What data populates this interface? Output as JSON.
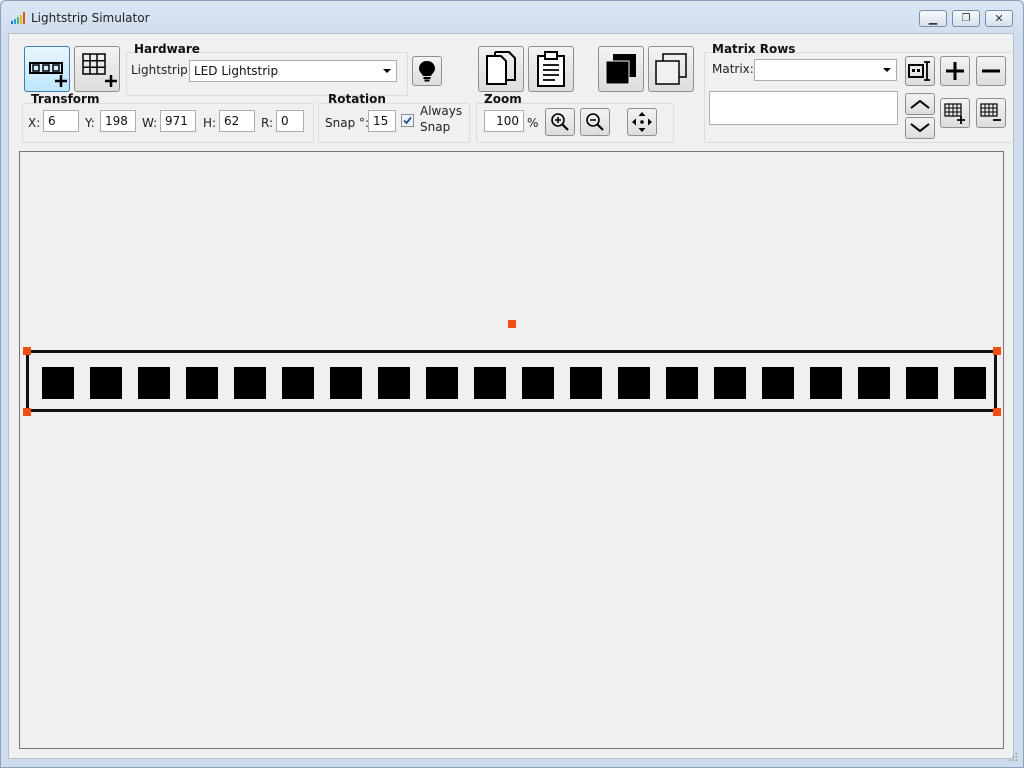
{
  "window": {
    "title": "Lightstrip Simulator",
    "minimize_icon": "minimize-icon",
    "maximize_icon": "restore-icon",
    "close_icon": "close-icon"
  },
  "toolbar": {
    "add_strip_icon": "add-lightstrip-icon",
    "add_matrix_icon": "add-matrix-icon",
    "hardware": {
      "header": "Hardware",
      "label": "Lightstrip:",
      "selected": "LED Lightstrip",
      "bulb_icon": "bulb-icon"
    },
    "transform": {
      "header": "Transform",
      "x_label": "X:",
      "x": "6",
      "y_label": "Y:",
      "y": "198",
      "w_label": "W:",
      "w": "971",
      "h_label": "H:",
      "h": "62",
      "r_label": "R:",
      "r": "0"
    },
    "rotation": {
      "header": "Rotation",
      "snap_label": "Snap °:",
      "snap": "15",
      "always_snap_line1": "Always",
      "always_snap_line2": "Snap",
      "always_snap_checked": true
    },
    "clipboard": {
      "copy_icon": "copy-icon",
      "paste_icon": "paste-icon"
    },
    "arrange": {
      "bring_front_icon": "bring-to-front-icon",
      "send_back_icon": "send-to-back-icon"
    },
    "zoom": {
      "header": "Zoom",
      "value": "100",
      "unit": "%",
      "zoom_in_icon": "zoom-in-icon",
      "zoom_out_icon": "zoom-out-icon",
      "pan_icon": "pan-icon"
    },
    "matrix_rows": {
      "header": "Matrix Rows",
      "label": "Matrix:",
      "selected": "",
      "rename_icon": "matrix-rename-icon",
      "add_icon": "plus-icon",
      "remove_icon": "minus-icon",
      "up_icon": "chevron-up-icon",
      "down_icon": "chevron-down-icon",
      "add_row_icon": "add-row-icon",
      "remove_row_icon": "remove-row-icon"
    }
  },
  "canvas": {
    "led_count": 20,
    "accent": "#f04c14"
  }
}
